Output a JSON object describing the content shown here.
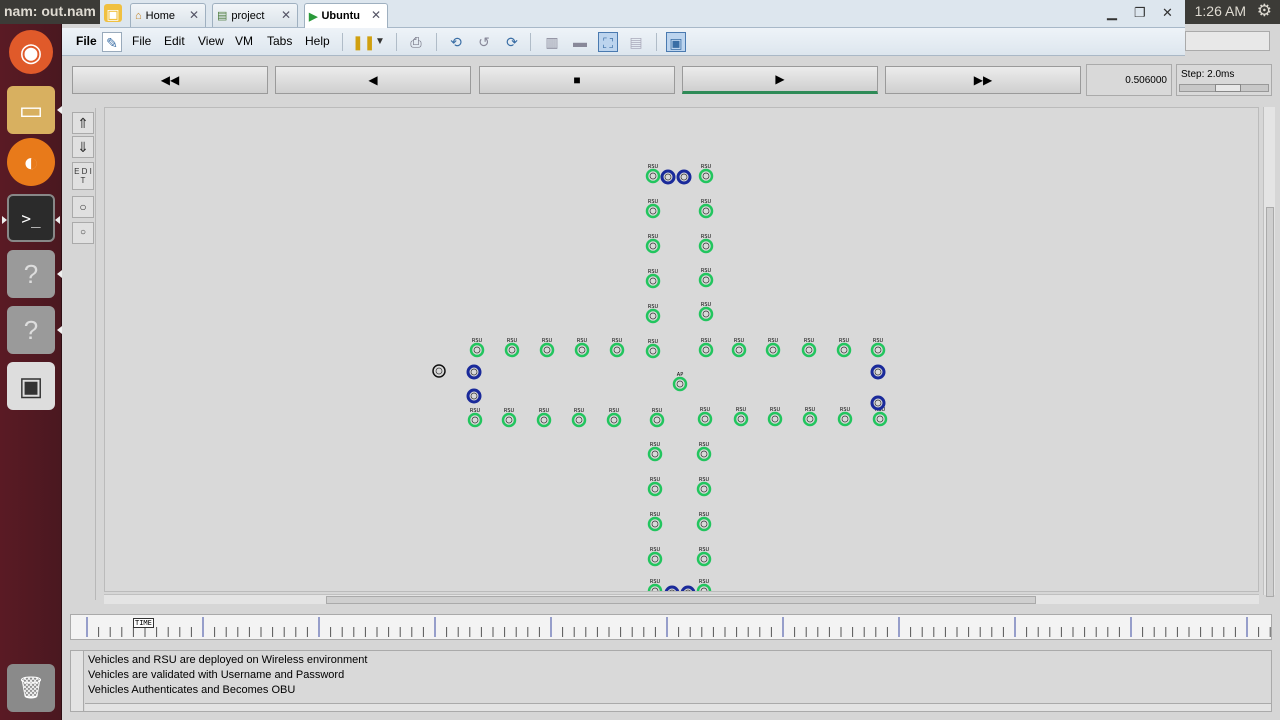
{
  "top_panel": {
    "title": "nam: out.nam",
    "clock": "1:26 AM",
    "gear_icon": "gear-icon"
  },
  "launcher": {
    "items": [
      {
        "name": "ubuntu-dash-icon",
        "glyph": "◉"
      },
      {
        "name": "file-manager-icon",
        "glyph": "▭"
      },
      {
        "name": "firefox-icon",
        "glyph": "◐"
      },
      {
        "name": "terminal-icon",
        "glyph": ">_"
      },
      {
        "name": "unknown-app-icon",
        "glyph": "?"
      },
      {
        "name": "unknown-app-icon",
        "glyph": "?"
      },
      {
        "name": "floppy-icon",
        "glyph": "▣"
      },
      {
        "name": "trash-icon",
        "glyph": "🗑"
      }
    ]
  },
  "vm_tabs": {
    "tabs": [
      {
        "label": "Home",
        "active": false
      },
      {
        "label": "project",
        "active": false
      },
      {
        "label": "Ubuntu",
        "active": true
      }
    ]
  },
  "vm_menu": {
    "file": "File",
    "edit": "Edit",
    "view": "View",
    "vm": "VM",
    "tabs": "Tabs",
    "help": "Help",
    "nam_file": "File"
  },
  "nam_controls": {
    "rewind": "◀◀",
    "back": "◀",
    "stop": "■",
    "play": "▶",
    "forward": "▶▶",
    "time": "0.506000",
    "step_label": "Step: 2.0ms",
    "step_level": 0.55
  },
  "tools": [
    "zoom-in",
    "zoom-out",
    "E D I T",
    "○",
    "○"
  ],
  "canvas": {
    "rsu_label": "RSU",
    "ap_label": "AP",
    "colors": {
      "rsu": "#22c55e",
      "vehicle": "#1a2a9a",
      "plain": "#111111"
    }
  },
  "timeline": {
    "marker": "TIME"
  },
  "annotations": [
    "Vehicles and RSU are deployed on Wireless environment",
    "Vehicles are validated with Username and Password",
    "Vehicles Authenticates and Becomes OBU"
  ]
}
